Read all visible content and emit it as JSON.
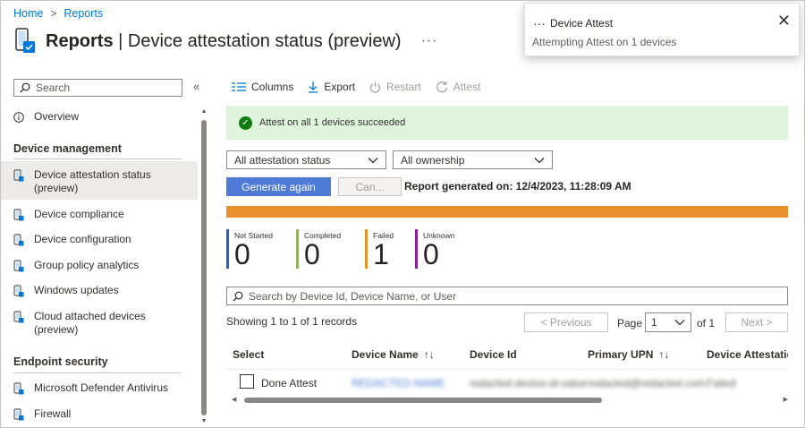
{
  "breadcrumb": {
    "home": "Home",
    "sep": ">",
    "reports": "Reports"
  },
  "header": {
    "title_bold": "Reports",
    "title_rest": " | Device attestation status (preview)",
    "more": "···"
  },
  "sidebar": {
    "search_placeholder": "Search",
    "collapse": "«",
    "overview": "Overview",
    "section_device_management": "Device management",
    "items": [
      {
        "label": "Device attestation status (preview)"
      },
      {
        "label": "Device compliance"
      },
      {
        "label": "Device configuration"
      },
      {
        "label": "Group policy analytics"
      },
      {
        "label": "Windows updates"
      },
      {
        "label": "Cloud attached devices (preview)"
      }
    ],
    "section_endpoint_security": "Endpoint security",
    "endpoint_items": [
      {
        "label": "Microsoft Defender Antivirus"
      },
      {
        "label": "Firewall"
      }
    ]
  },
  "toolbar": {
    "columns": "Columns",
    "export": "Export",
    "restart": "Restart",
    "attest": "Attest"
  },
  "banner": {
    "text": "Attest on all 1 devices succeeded"
  },
  "filters": {
    "status": "All attestation status",
    "ownership": "All ownership"
  },
  "actions": {
    "generate": "Generate again",
    "cancel": "Can...",
    "report_generated": "Report generated on: 12/4/2023, 11:28:09 AM"
  },
  "counters": [
    {
      "label": "Not Started",
      "value": "0",
      "color": "#2b5eb8"
    },
    {
      "label": "Completed",
      "value": "0",
      "color": "#8cbd2d"
    },
    {
      "label": "Failed",
      "value": "1",
      "color": "#e8912d"
    },
    {
      "label": "Unknown",
      "value": "0",
      "color": "#8a1e9a"
    }
  ],
  "table": {
    "search_placeholder": "Search by Device Id, Device Name, or User",
    "showing": "Showing 1 to 1 of 1 records",
    "prev": "< Previous",
    "page_label": "Page",
    "page_value": "1",
    "of": "of 1",
    "next": "Next >",
    "columns": {
      "select": "Select",
      "device_name": "Device Name",
      "device_id": "Device Id",
      "primary_upn": "Primary UPN",
      "attestation": "Device Attestation"
    },
    "row": {
      "select_label": "Done Attest",
      "device_name": "REDACTED-NAME",
      "device_id": "redacted-device-id-value",
      "primary_upn": "redacted@redacted.com",
      "attestation": "Failed"
    }
  },
  "toast": {
    "icon": "···",
    "title": "Device Attest",
    "body": "Attempting Attest on 1 devices",
    "close": "✕"
  }
}
